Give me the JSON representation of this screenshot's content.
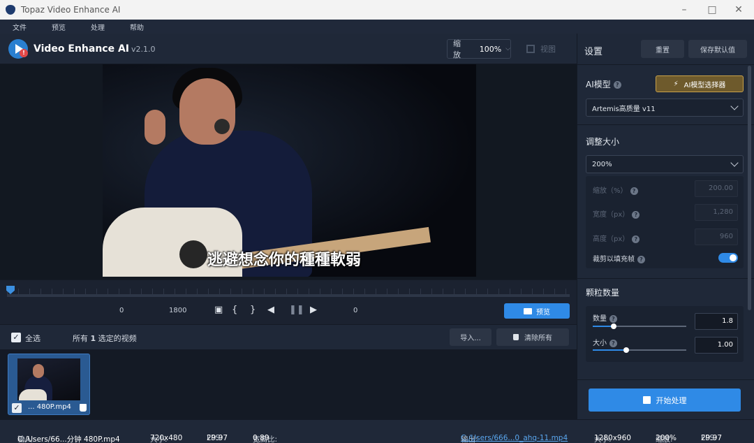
{
  "window": {
    "title": "Topaz Video Enhance AI"
  },
  "menu": [
    "文件",
    "预览",
    "处理",
    "帮助"
  ],
  "brand": {
    "name": "Video Enhance AI",
    "version": "v2.1.0"
  },
  "zoom": {
    "label": "缩放",
    "value": "100%"
  },
  "view": {
    "label": "视图"
  },
  "video": {
    "subtitle": "逃避想念你的種種軟弱"
  },
  "timeline": {
    "start": "0",
    "end": "1800",
    "current": "0",
    "preview_label": "预览"
  },
  "filebar": {
    "select_all": "全选",
    "summary_prefix": "所有 ",
    "summary_count": "1",
    "summary_suffix": " 选定的视频",
    "import_label": "导入...",
    "clear_label": "清除所有"
  },
  "thumbnail": {
    "name": "... 480P.mp4"
  },
  "settings": {
    "title": "设置",
    "reset_label": "重置",
    "save_default_label": "保存默认值",
    "ai_model_label": "AI模型",
    "model_picker_label": "AI模型选择器",
    "model_value": "Artemis高质量 v11",
    "resize_label": "调整大小",
    "resize_value": "200%",
    "scale_label": "缩放（%）",
    "scale_value": "200.00",
    "width_label": "宽度（px）",
    "width_value": "1,280",
    "height_label": "高度（px）",
    "height_value": "960",
    "crop_label": "裁剪以填充帧",
    "crop_on": true,
    "grain_label": "颗粒数量",
    "amount_label": "数量",
    "amount_value": "1.8",
    "size_label": "大小",
    "size_value": "1.00",
    "start_label": "开始处理"
  },
  "status": {
    "input_label": "输入:",
    "input_path": "C:/Users/66...分钟 480P.mp4",
    "in_size_label": "大小:",
    "in_size": "720x480",
    "in_fps_label": "FPS:",
    "in_fps": "29.97",
    "aspect_label": "宽高比:",
    "aspect": "0.89",
    "output_label": "输出:",
    "output_path": "C:/Users/666...0_ahq-11.mp4",
    "out_size_label": "大小:",
    "out_size": "1280x960",
    "out_zoom_label": "缩放:",
    "out_zoom": "200%",
    "out_fps_label": "FPS:",
    "out_fps": "29.97"
  }
}
